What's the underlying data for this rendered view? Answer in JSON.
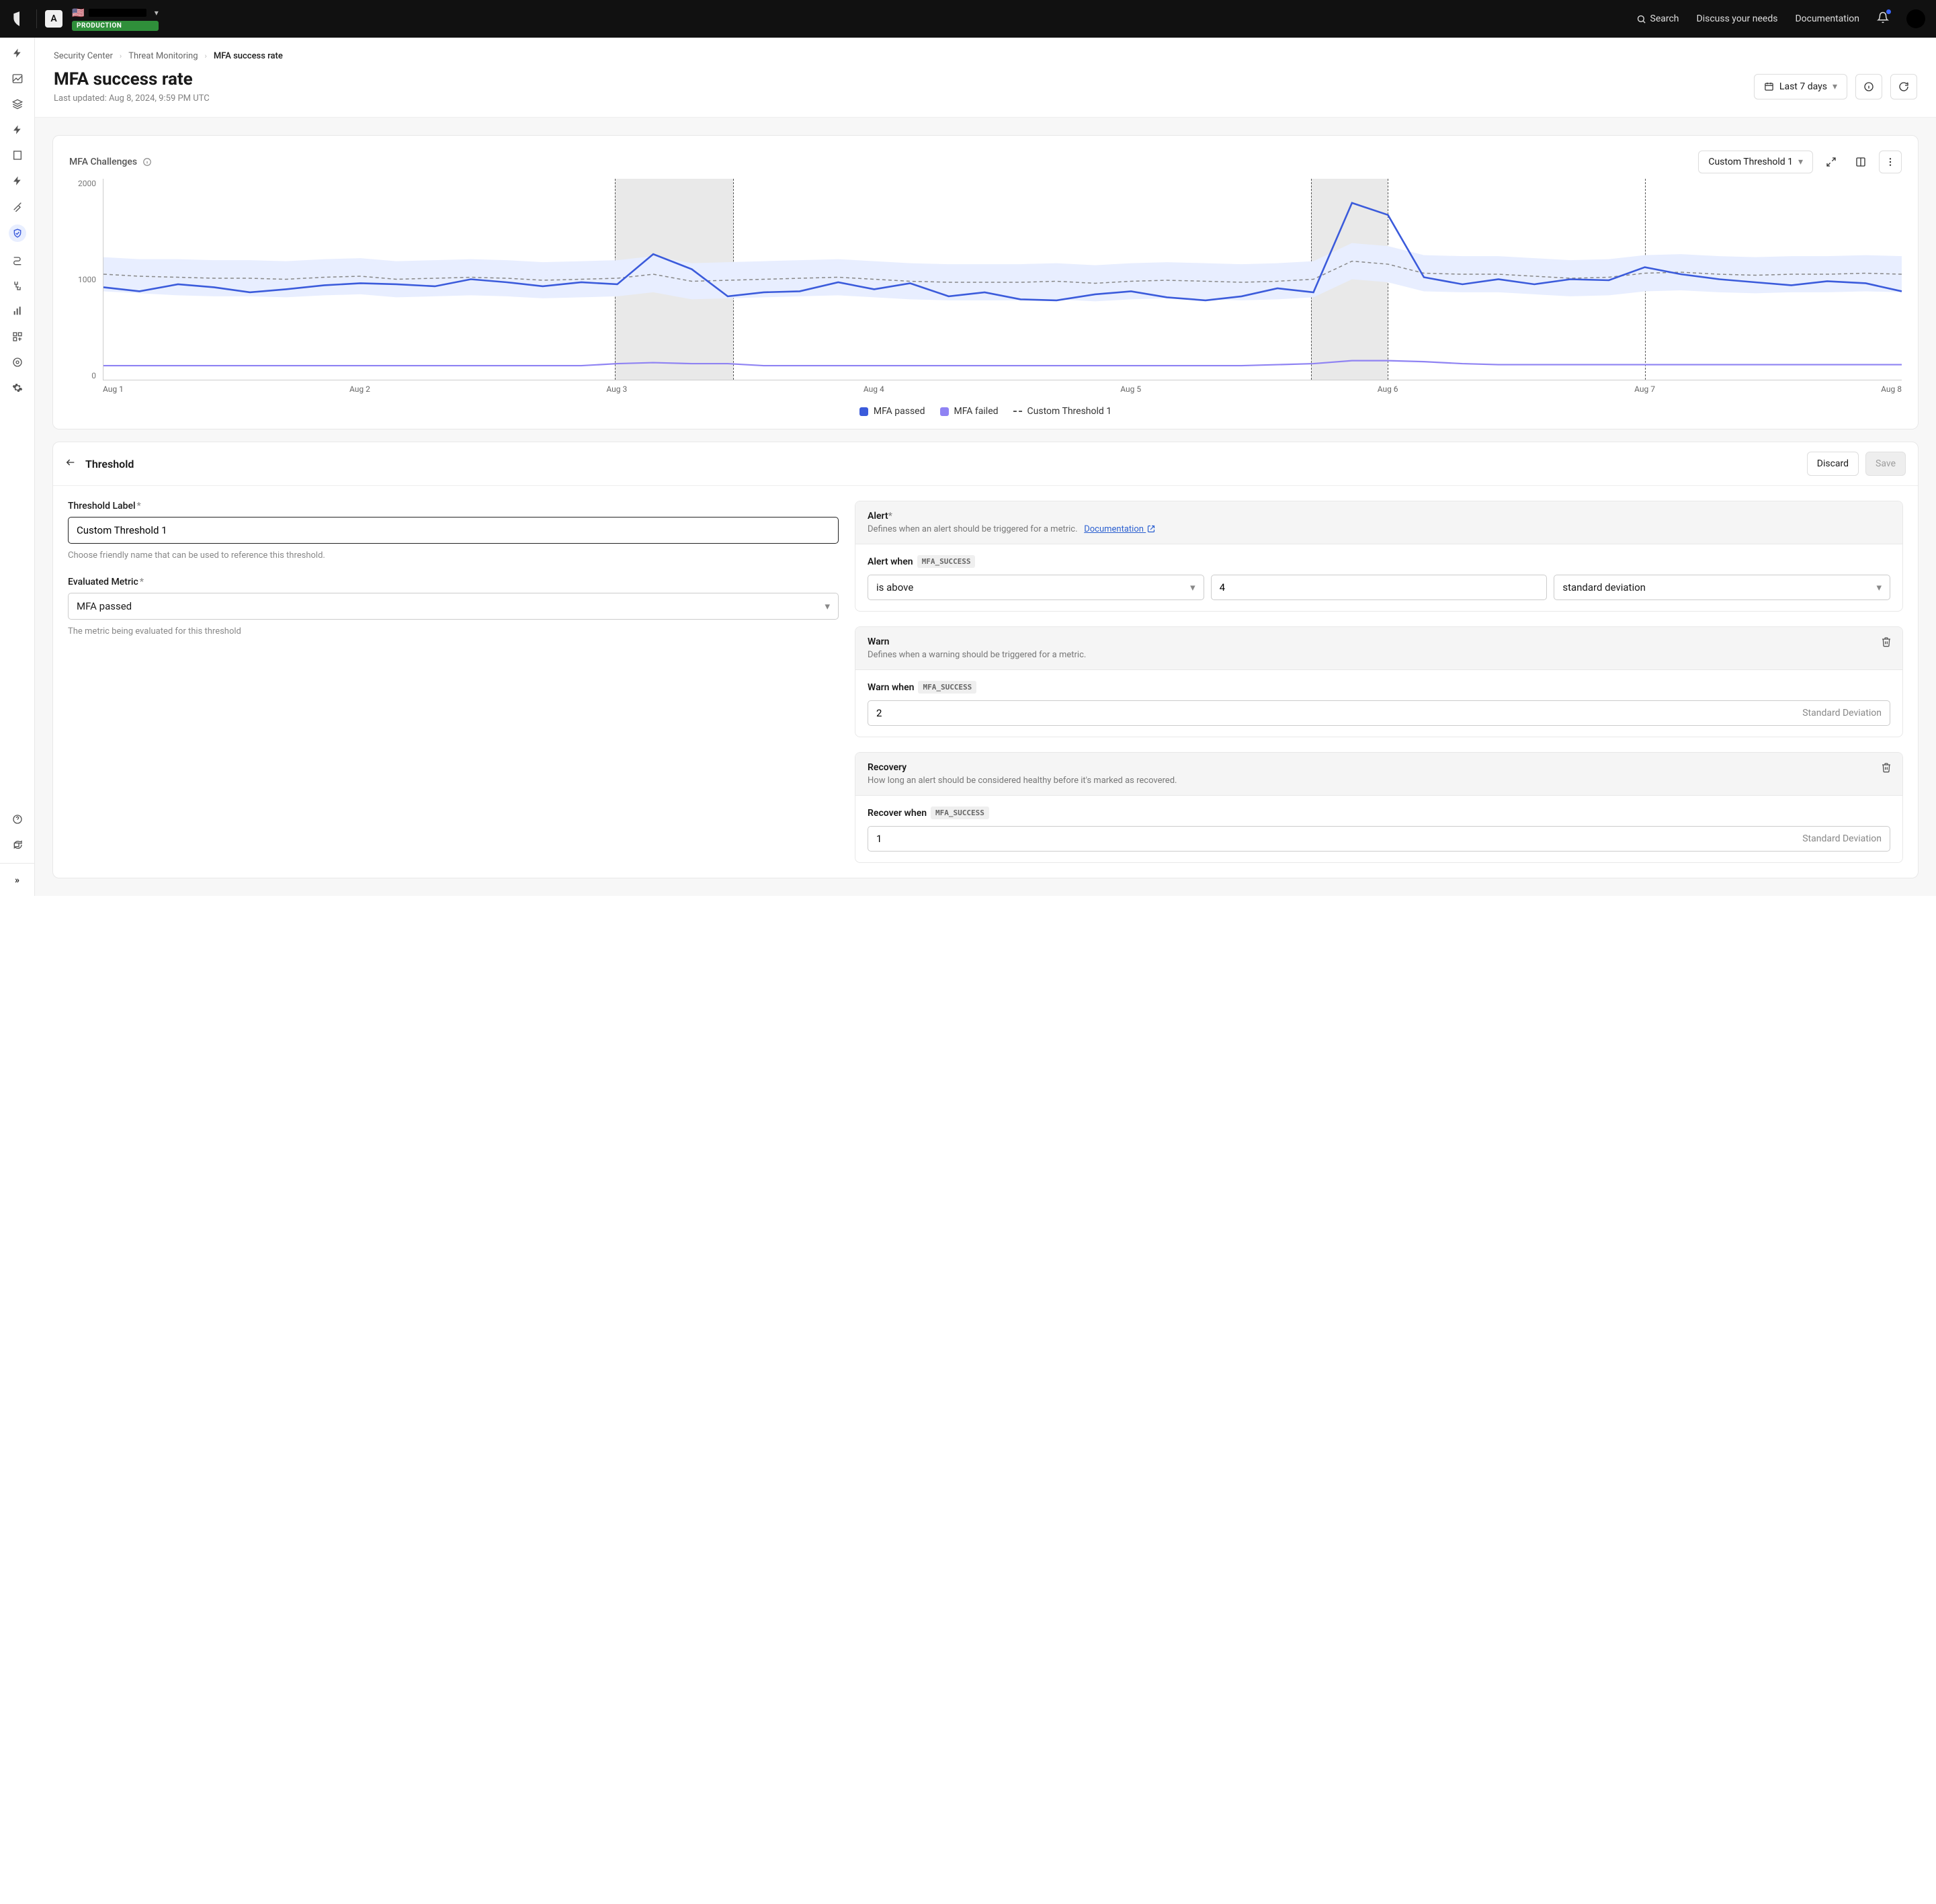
{
  "topbar": {
    "app_tile": "A",
    "env_badge": "PRODUCTION",
    "search": "Search",
    "discuss": "Discuss your needs",
    "documentation": "Documentation"
  },
  "breadcrumb": {
    "a": "Security Center",
    "b": "Threat Monitoring",
    "c": "MFA success rate"
  },
  "page": {
    "title": "MFA success rate",
    "subtitle": "Last updated: Aug 8, 2024, 9:59 PM UTC",
    "range": "Last 7 days"
  },
  "chart_card": {
    "title": "MFA Challenges",
    "threshold_selector": "Custom Threshold 1",
    "legend": {
      "passed": "MFA passed",
      "failed": "MFA failed",
      "threshold": "Custom Threshold 1"
    }
  },
  "chart_data": {
    "type": "line",
    "title": "MFA Challenges",
    "ylabel": "",
    "xlabel": "",
    "ylim": [
      0,
      2000
    ],
    "yticks": [
      0,
      1000,
      2000
    ],
    "categories": [
      "Aug 1",
      "Aug 2",
      "Aug 3",
      "Aug 4",
      "Aug 5",
      "Aug 6",
      "Aug 7",
      "Aug 8"
    ],
    "x": [
      1.0,
      1.14,
      1.29,
      1.43,
      1.57,
      1.71,
      1.86,
      2.0,
      2.14,
      2.29,
      2.43,
      2.57,
      2.71,
      2.86,
      3.0,
      3.14,
      3.29,
      3.43,
      3.57,
      3.71,
      3.86,
      4.0,
      4.14,
      4.29,
      4.43,
      4.57,
      4.71,
      4.86,
      5.0,
      5.14,
      5.29,
      5.43,
      5.57,
      5.71,
      5.86,
      6.0,
      6.14,
      6.29,
      6.43,
      6.57,
      6.71,
      6.86,
      7.0,
      7.14,
      7.29,
      7.43,
      7.57,
      7.71,
      7.86,
      8.0
    ],
    "series": [
      {
        "name": "MFA passed",
        "color": "#3b5bdb",
        "values": [
          920,
          880,
          950,
          920,
          870,
          900,
          940,
          960,
          950,
          930,
          1000,
          970,
          930,
          970,
          950,
          1250,
          1100,
          830,
          870,
          880,
          970,
          900,
          960,
          830,
          870,
          800,
          790,
          850,
          880,
          820,
          790,
          830,
          910,
          870,
          1760,
          1640,
          1020,
          950,
          1000,
          950,
          1000,
          990,
          1120,
          1050,
          1000,
          970,
          940,
          980,
          960,
          880
        ]
      },
      {
        "name": "MFA failed",
        "color": "#8f83f3",
        "values": [
          140,
          140,
          140,
          140,
          140,
          140,
          140,
          140,
          140,
          140,
          140,
          140,
          140,
          140,
          160,
          170,
          160,
          160,
          140,
          140,
          140,
          140,
          140,
          140,
          140,
          140,
          140,
          140,
          140,
          140,
          140,
          140,
          150,
          160,
          190,
          190,
          180,
          160,
          150,
          150,
          150,
          150,
          150,
          150,
          150,
          150,
          150,
          150,
          150,
          150
        ]
      },
      {
        "name": "Custom Threshold 1",
        "color": "#888",
        "style": "dashed",
        "values": [
          1050,
          1030,
          1020,
          1010,
          1010,
          1000,
          1020,
          1030,
          1000,
          1010,
          1020,
          1010,
          990,
          1000,
          1010,
          1050,
          980,
          990,
          1000,
          1010,
          1020,
          1000,
          980,
          970,
          970,
          970,
          980,
          960,
          980,
          990,
          980,
          970,
          980,
          1000,
          1180,
          1150,
          1060,
          1050,
          1050,
          1030,
          1010,
          1020,
          1060,
          1070,
          1050,
          1040,
          1050,
          1050,
          1060,
          1050
        ]
      },
      {
        "name": "Band upper",
        "color": "#e8eeff",
        "hidden_legend": true,
        "values": [
          1220,
          1200,
          1200,
          1190,
          1190,
          1180,
          1200,
          1210,
          1180,
          1190,
          1200,
          1190,
          1170,
          1180,
          1190,
          1230,
          1160,
          1170,
          1180,
          1190,
          1200,
          1180,
          1160,
          1150,
          1150,
          1150,
          1160,
          1140,
          1160,
          1170,
          1160,
          1150,
          1160,
          1180,
          1360,
          1330,
          1240,
          1230,
          1230,
          1210,
          1190,
          1200,
          1240,
          1250,
          1230,
          1220,
          1230,
          1230,
          1240,
          1230
        ]
      }
    ],
    "anomaly_regions": [
      {
        "start": 2.99,
        "end": 3.45
      },
      {
        "start": 5.7,
        "end": 6.0
      },
      {
        "start": 7.0,
        "end": 7.0
      }
    ]
  },
  "threshold_panel": {
    "title": "Threshold",
    "discard": "Discard",
    "save": "Save",
    "label_field": {
      "label": "Threshold Label",
      "value": "Custom Threshold 1",
      "helper": "Choose friendly name that can be used to reference this threshold."
    },
    "metric_field": {
      "label": "Evaluated Metric",
      "value": "MFA passed",
      "helper": "The metric being evaluated for this threshold"
    },
    "alert_block": {
      "title": "Alert",
      "desc": "Defines when an alert should be triggered for a metric.",
      "doc": "Documentation",
      "when_label": "Alert when",
      "tag": "MFA_SUCCESS",
      "comparator": "is above",
      "value": "4",
      "unit": "standard deviation"
    },
    "warn_block": {
      "title": "Warn",
      "desc": "Defines when a warning should be triggered for a metric.",
      "when_label": "Warn when",
      "tag": "MFA_SUCCESS",
      "value": "2",
      "suffix": "Standard Deviation"
    },
    "recovery_block": {
      "title": "Recovery",
      "desc": "How long an alert should be considered healthy before it's marked as recovered.",
      "when_label": "Recover when",
      "tag": "MFA_SUCCESS",
      "value": "1",
      "suffix": "Standard Deviation"
    }
  }
}
